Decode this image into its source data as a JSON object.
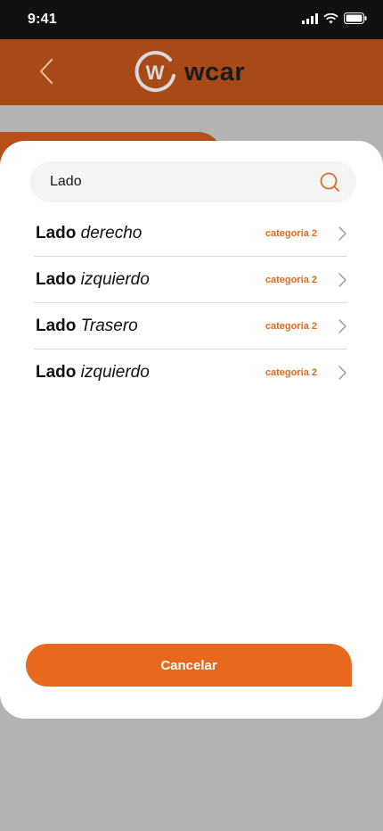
{
  "status_bar": {
    "time": "9:41"
  },
  "header": {
    "logo_text": "wcar",
    "logo_mark": "W"
  },
  "search": {
    "value": "Lado",
    "placeholder": ""
  },
  "results": [
    {
      "bold": "Lado",
      "rest": "derecho",
      "category": "categoria 2"
    },
    {
      "bold": "Lado",
      "rest": "izquierdo",
      "category": "categoria 2"
    },
    {
      "bold": "Lado",
      "rest": "Trasero",
      "category": "categoria 2"
    },
    {
      "bold": "Lado",
      "rest": "izquierdo",
      "category": "categoria 2"
    }
  ],
  "cancel_label": "Cancelar",
  "colors": {
    "header": "#a84a17",
    "accent": "#e8691e",
    "overlay": "#b3b3b3"
  }
}
